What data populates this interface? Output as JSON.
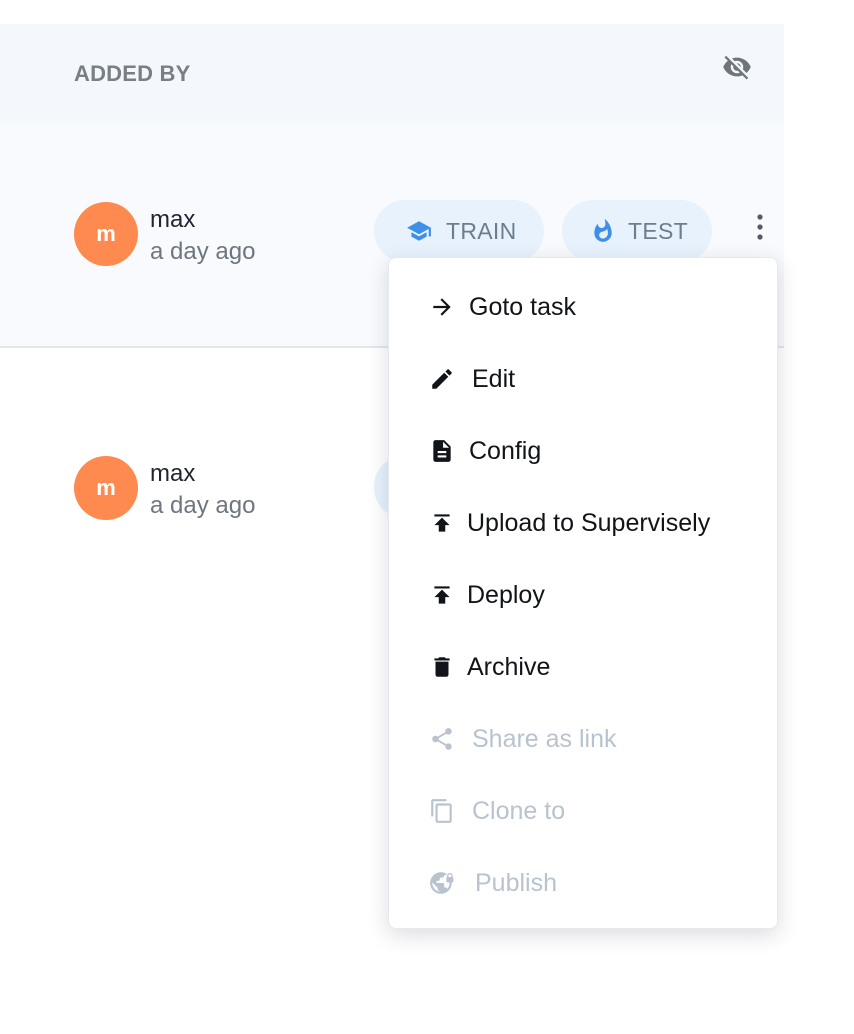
{
  "header": {
    "column_title": "ADDED BY",
    "visibility_icon": "eye-off-icon"
  },
  "rows": [
    {
      "avatar_letter": "m",
      "user": "max",
      "time": "a day ago",
      "chips": [
        {
          "label": "TRAIN",
          "icon": "graduation-cap-icon"
        },
        {
          "label": "TEST",
          "icon": "flame-icon"
        }
      ]
    },
    {
      "avatar_letter": "m",
      "user": "max",
      "time": "a day ago"
    }
  ],
  "context_menu": {
    "items": [
      {
        "label": "Goto task",
        "icon": "arrow-right-icon",
        "disabled": false
      },
      {
        "label": "Edit",
        "icon": "pencil-icon",
        "disabled": false
      },
      {
        "label": "Config",
        "icon": "document-icon",
        "disabled": false
      },
      {
        "label": "Upload to Supervisely",
        "icon": "upload-icon",
        "disabled": false
      },
      {
        "label": "Deploy",
        "icon": "upload-icon",
        "disabled": false
      },
      {
        "label": "Archive",
        "icon": "trash-icon",
        "disabled": false
      },
      {
        "label": "Share as link",
        "icon": "share-icon",
        "disabled": true
      },
      {
        "label": "Clone to",
        "icon": "copy-icon",
        "disabled": true
      },
      {
        "label": "Publish",
        "icon": "globe-lock-icon",
        "disabled": true
      }
    ]
  },
  "colors": {
    "avatar": "#ff8a4f",
    "chip_bg": "#e7f2fd",
    "chip_icon": "#3d8fe8",
    "disabled_text": "#b9c3cf",
    "header_bg": "#f4f8fc"
  }
}
